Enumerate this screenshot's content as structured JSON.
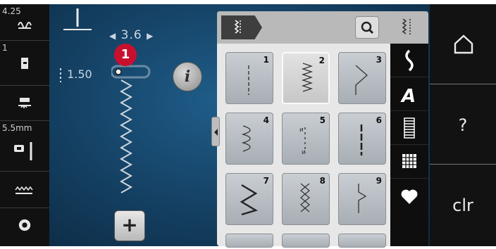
{
  "status": {
    "stitch_width_top": "4.25",
    "presser_foot": "1",
    "needle_size": "5.5mm"
  },
  "controls": {
    "width_value": "3.6",
    "length_value": "1.50",
    "info_label": "i",
    "add_label": "+",
    "badge": "1"
  },
  "patterns": [
    {
      "num": "1",
      "icon": "straight-stitch-icon",
      "selected": false
    },
    {
      "num": "2",
      "icon": "zigzag-stitch-icon",
      "selected": true
    },
    {
      "num": "3",
      "icon": "blind-stitch-icon",
      "selected": false
    },
    {
      "num": "4",
      "icon": "vari-overlock-icon",
      "selected": false
    },
    {
      "num": "5",
      "icon": "running-stitch-icon",
      "selected": false
    },
    {
      "num": "6",
      "icon": "triple-straight-icon",
      "selected": false
    },
    {
      "num": "7",
      "icon": "triple-zigzag-icon",
      "selected": false
    },
    {
      "num": "8",
      "icon": "honeycomb-icon",
      "selected": false
    },
    {
      "num": "9",
      "icon": "blind-hem-icon",
      "selected": false
    }
  ],
  "categories": [
    "practical-stitches-icon",
    "decorative-stitches-icon",
    "alphabet-icon",
    "buttonhole-icon",
    "quilt-stitch-icon",
    "favorites-icon"
  ],
  "right": {
    "home_label": "home-icon",
    "help_label": "?",
    "clear_label": "clr"
  }
}
